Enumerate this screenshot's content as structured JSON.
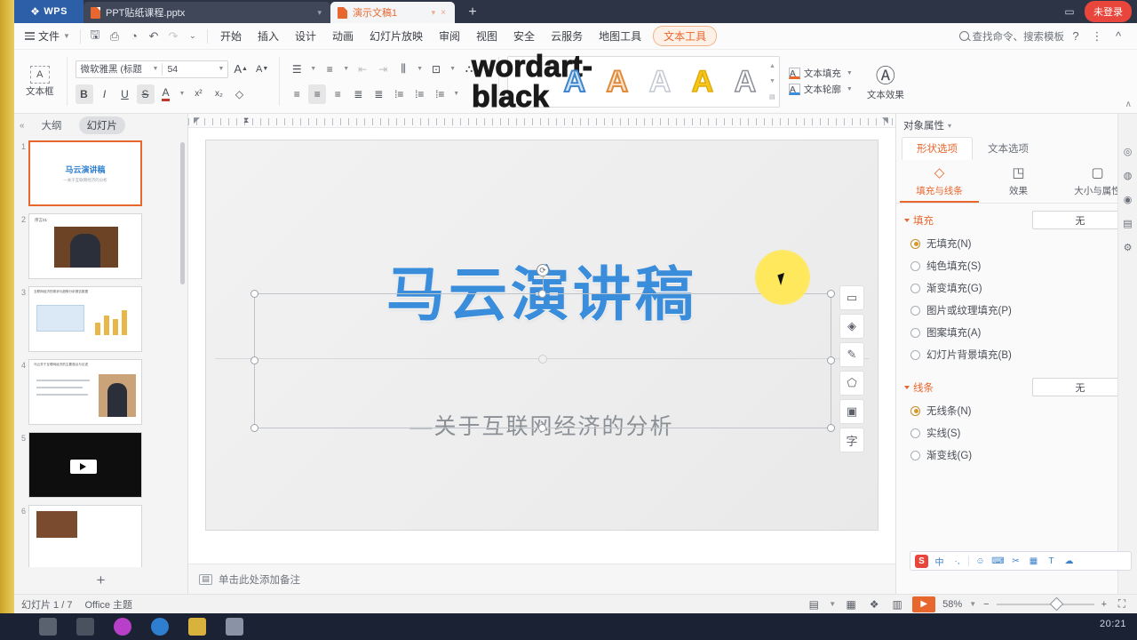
{
  "titlebar": {
    "app_logo": "WPS",
    "tabs": [
      {
        "name": "PPT贴纸课程.pptx",
        "icon": "ppt-file-icon",
        "active": true
      },
      {
        "name": "演示文稿1",
        "icon": "ppt-file-icon",
        "active": false
      }
    ],
    "new_tab": "+",
    "cloud_label": "未登录",
    "window_buttons": [
      "minimize-icon",
      "maximize-icon",
      "close-icon"
    ]
  },
  "menubar": {
    "file_label": "文件",
    "quick_icons": [
      "save-icon",
      "print-icon",
      "print-preview-icon",
      "undo-icon",
      "redo-icon",
      "customize-icon"
    ],
    "items": [
      "开始",
      "插入",
      "设计",
      "动画",
      "幻灯片放映",
      "审阅",
      "视图",
      "安全",
      "云服务",
      "地图工具"
    ],
    "active_item": "文本工具",
    "search_placeholder": "查找命令、搜索模板",
    "help_label": "?",
    "more_label": "⋮",
    "collapse_label": "^"
  },
  "ribbon": {
    "text_frame_label": "文本框",
    "font_name": "微软雅黑 (标题",
    "font_size": "54",
    "grow_font": "A",
    "shrink_font": "A",
    "bold": "B",
    "italic": "I",
    "underline": "U",
    "strikethrough": "S",
    "text_color": "A",
    "superscript": "x²",
    "subscript": "x₂",
    "clear_format": "◇",
    "wordart_styles": [
      {
        "name": "wordart-black",
        "color": "#1a1a1a",
        "outline": "#1a1a1a"
      },
      {
        "name": "wordart-blue",
        "color": "#4a90d9",
        "outline": "#2f6fae"
      },
      {
        "name": "wordart-orange",
        "color": "#e08a3c",
        "outline": "#c3702a"
      },
      {
        "name": "wordart-white",
        "color": "#ffffff",
        "outline": "#b9bec6"
      },
      {
        "name": "wordart-yellow",
        "color": "#f0b91c",
        "outline": "#d4a211"
      },
      {
        "name": "wordart-gray",
        "color": "#8a8f98",
        "outline": "#6a6f79"
      }
    ],
    "text_fill_label": "文本填充",
    "text_outline_label": "文本轮廓",
    "text_effect_label": "文本效果",
    "collapse_label": "∧"
  },
  "left_panel": {
    "collapse_icon": "«",
    "tabs": [
      {
        "label": "大纲",
        "active": false
      },
      {
        "label": "幻灯片",
        "active": true
      }
    ],
    "slides": [
      {
        "number": "1",
        "type": "title",
        "title": "马云演讲稿",
        "subtitle": "—关于互联网经济的分析",
        "selected": true
      },
      {
        "number": "2",
        "type": "photo",
        "heading": "序言01",
        "selected": false
      },
      {
        "number": "3",
        "type": "chart",
        "heading": "互联网经济的现状与趋势分析报告数据",
        "selected": false
      },
      {
        "number": "4",
        "type": "photo-right",
        "heading": "马云关于互联网经济的主要观点与论述",
        "selected": false
      },
      {
        "number": "5",
        "type": "video",
        "heading": "",
        "selected": false
      },
      {
        "number": "6",
        "type": "photo",
        "heading": "",
        "selected": false
      }
    ],
    "add_slide_label": "+"
  },
  "slide": {
    "title": "马云演讲稿",
    "subtitle": "—关于互联网经济的分析",
    "side_tools": [
      "more-icon",
      "shape-style-icon",
      "pen-icon",
      "fill-icon",
      "size-icon",
      "text-format-icon"
    ]
  },
  "notes": {
    "icon": "notes-icon",
    "placeholder": "单击此处添加备注"
  },
  "right_panel": {
    "title": "对象属性",
    "title_chevron": "▾",
    "close_icon": "×",
    "tabs": [
      {
        "label": "形状选项",
        "active": true
      },
      {
        "label": "文本选项",
        "active": false
      }
    ],
    "subtabs": [
      {
        "label": "填充与线条",
        "icon": "fill-line-icon",
        "active": true
      },
      {
        "label": "效果",
        "icon": "effects-icon",
        "active": false
      },
      {
        "label": "大小与属性",
        "icon": "size-properties-icon",
        "active": false
      }
    ],
    "fill_section": {
      "header": "填充",
      "select_value": "无",
      "options": [
        {
          "label": "无填充(N)",
          "selected": true
        },
        {
          "label": "纯色填充(S)",
          "selected": false
        },
        {
          "label": "渐变填充(G)",
          "selected": false
        },
        {
          "label": "图片或纹理填充(P)",
          "selected": false
        },
        {
          "label": "图案填充(A)",
          "selected": false
        },
        {
          "label": "幻灯片背景填充(B)",
          "selected": false
        }
      ]
    },
    "line_section": {
      "header": "线条",
      "select_value": "无",
      "options": [
        {
          "label": "无线条(N)",
          "selected": true
        },
        {
          "label": "实线(S)",
          "selected": false
        },
        {
          "label": "渐变线(G)",
          "selected": false
        }
      ]
    },
    "rail_icons": [
      "help-rail-icon",
      "feedback-rail-icon",
      "share-rail-icon",
      "doc-rail-icon",
      "tool-rail-icon"
    ]
  },
  "ime": {
    "logo": "S",
    "items": [
      "中",
      "·,",
      "☺",
      "⌨",
      "✂",
      "▦",
      "T",
      "☁"
    ]
  },
  "statusbar": {
    "slide_counter": "幻灯片 1 / 7",
    "theme": "Office 主题",
    "view_icons": [
      "normal-view-icon",
      "sorter-view-icon",
      "reading-view-icon",
      "notes-view-icon"
    ],
    "play_label": "▶",
    "zoom_level": "58%",
    "zoom_out": "−",
    "zoom_in": "+",
    "fit_label": "⛶"
  },
  "taskbar": {
    "icons": [
      "folder-icon",
      "mail-icon",
      "media-icon",
      "browser-icon",
      "notes-icon",
      "files-icon"
    ],
    "clock": "20:21"
  },
  "colors": {
    "accent": "#e8672e",
    "title_blue": "#3a8ddb",
    "titlebar_bg": "#2d3445",
    "highlight_yellow": "#ffe85c"
  }
}
